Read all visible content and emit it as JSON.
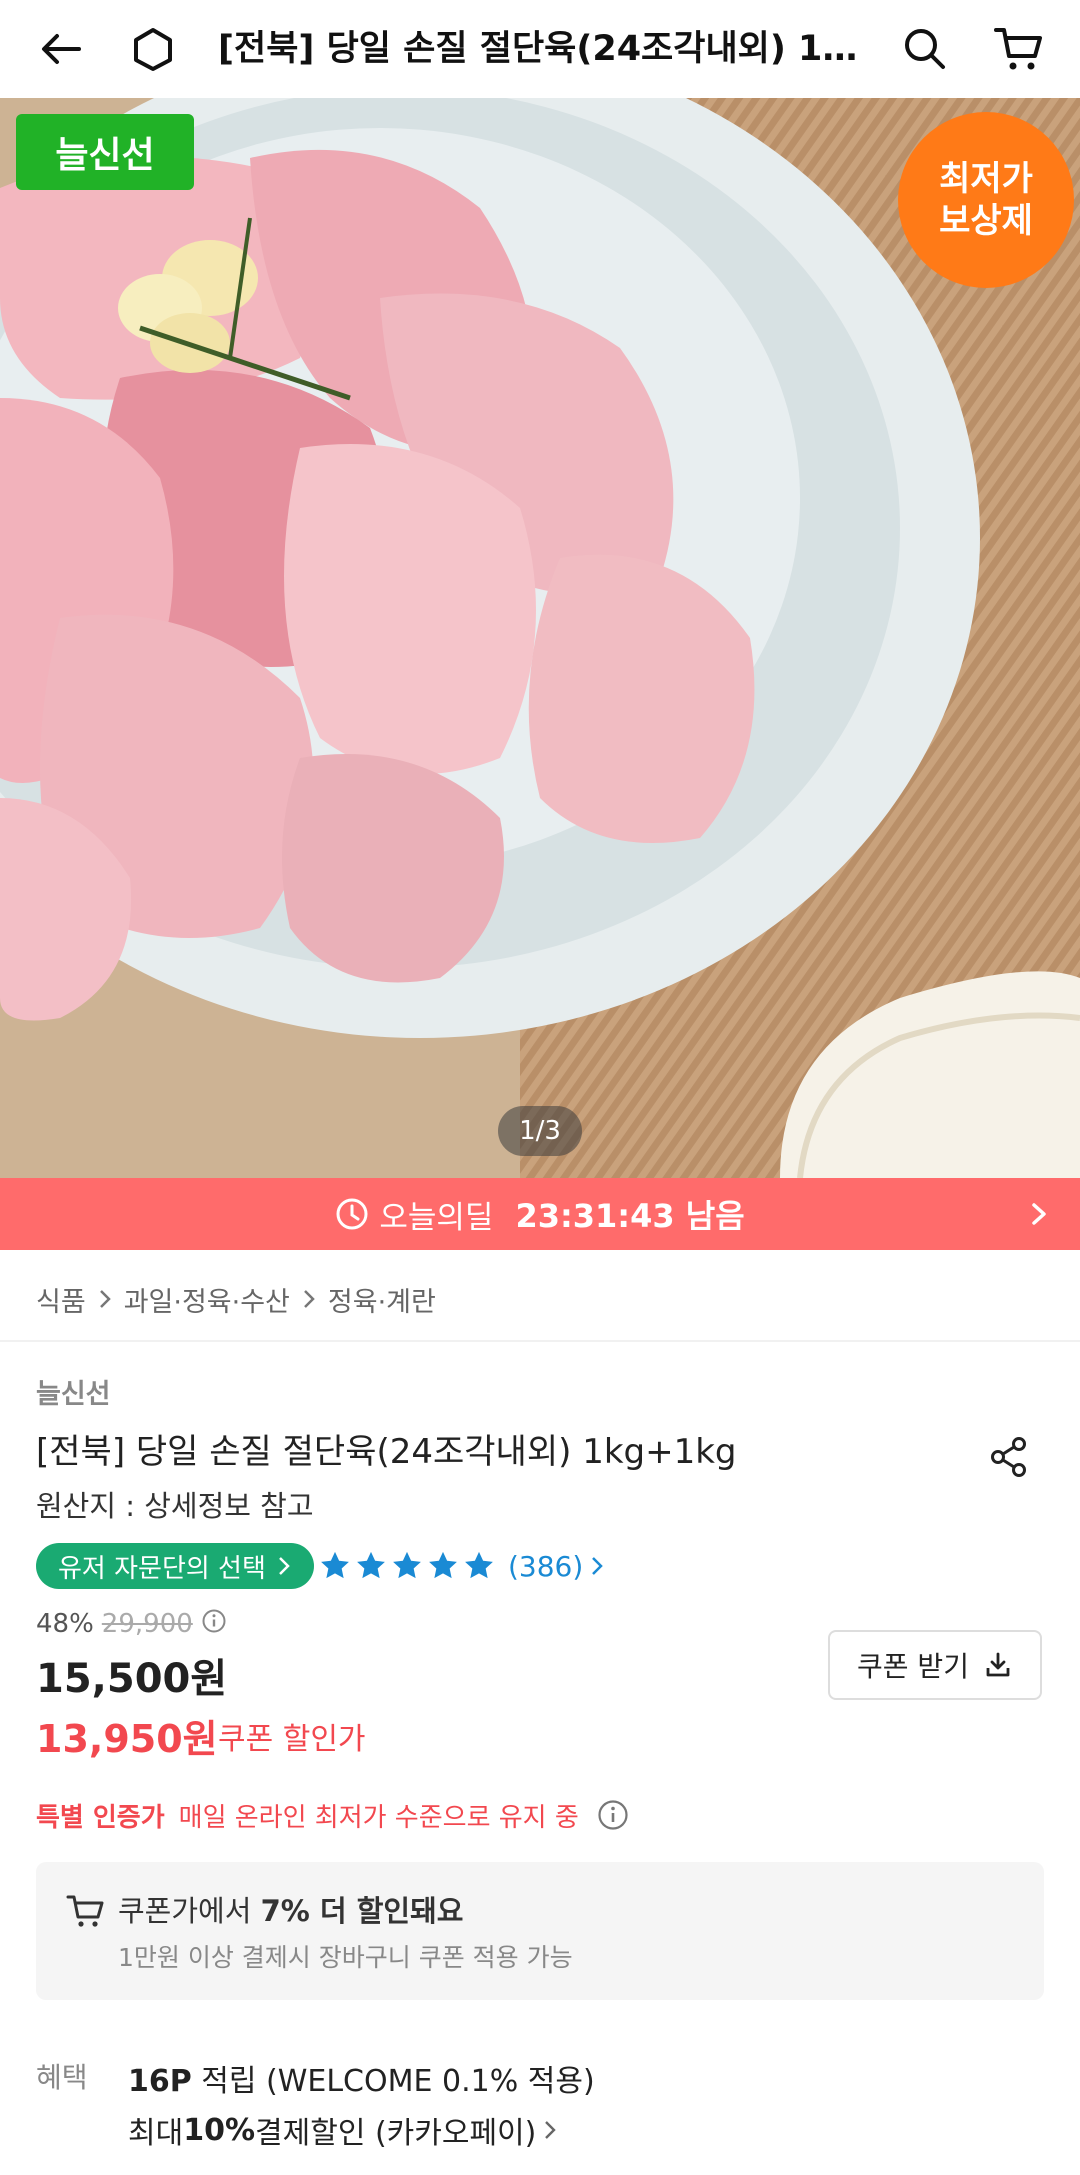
{
  "header": {
    "back_icon": "arrow-left-icon",
    "home_icon": "home-icon",
    "title": "[전북] 당일 손질 절단육(24조각내외) 1kg+1kg",
    "search_icon": "search-icon",
    "cart_icon": "cart-icon"
  },
  "hero": {
    "fresh_badge": "늘신선",
    "lowest_badge_line1": "최저가",
    "lowest_badge_line2": "보상제",
    "page_indicator": "1/3"
  },
  "deal": {
    "label": "오늘의딜",
    "time_left": "23:31:43 남음",
    "accent": "#ff6b6b"
  },
  "breadcrumb": [
    "식품",
    "과일·정육·수산",
    "정육·계란"
  ],
  "product": {
    "brand": "늘신선",
    "title": "[전북] 당일 손질 절단육(24조각내외) 1kg+1kg",
    "origin": "원산지 : 상세정보 참고",
    "choice_badge": "유저 자문단의 선택",
    "rating_stars": 5,
    "review_count": "(386)",
    "discount_rate": "48%",
    "original_price": "29,900",
    "price": "15,500원",
    "coupon_price": "13,950원",
    "coupon_price_label": "쿠폰 할인가",
    "coupon_button": "쿠폰 받기",
    "certified_label": "특별 인증가",
    "certified_text": "매일 온라인 최저가 수준으로 유지 중"
  },
  "coupon_box": {
    "line1_prefix": "쿠폰가에서 ",
    "line1_bold": "7% 더 할인돼요",
    "line2": "1만원 이상 결제시 장바구니 쿠폰 적용 가능"
  },
  "benefits": {
    "label": "혜택",
    "item1_bold": "16P",
    "item1_text": " 적립 (WELCOME 0.1% 적용)",
    "item2_prefix": "최대 ",
    "item2_bold": "10%",
    "item2_text": " 결제할인 (카카오페이)"
  },
  "colors": {
    "green": "#21b227",
    "orange": "#ff7a17",
    "red": "#f2484f",
    "teal": "#1aaa72",
    "blue": "#1a8ad4"
  }
}
